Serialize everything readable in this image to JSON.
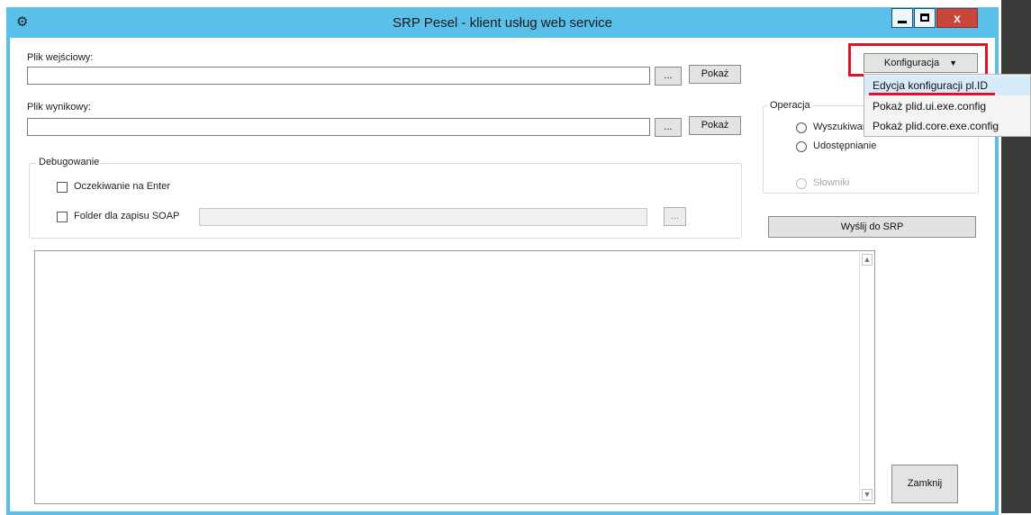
{
  "window": {
    "title": "SRP Pesel - klient usług web service",
    "app_icon": "gear-icon",
    "close_glyph": "x",
    "accent_color": "#5bc0e9"
  },
  "input_file": {
    "label": "Plik wejściowy:",
    "value": "",
    "browse_label": "...",
    "show_label": "Pokaż"
  },
  "output_file": {
    "label": "Plik wynikowy:",
    "value": "",
    "browse_label": "...",
    "show_label": "Pokaż"
  },
  "debug": {
    "title": "Debugowanie",
    "wait_enter_label": "Oczekiwanie na Enter",
    "wait_enter_checked": false,
    "soap_folder_label": "Folder dla zapisu SOAP",
    "soap_folder_checked": false,
    "soap_folder_value": "",
    "browse_label": "..."
  },
  "config": {
    "button_label": "Konfiguracja",
    "menu_items": [
      "Edycja konfiguracji pl.ID",
      "Pokaż plid.ui.exe.config",
      "Pokaż plid.core.exe.config"
    ],
    "highlight_color": "#e0112b"
  },
  "operation": {
    "title": "Operacja",
    "options": [
      "Wyszukiwanie",
      "Udostępnianie",
      "Słowniki"
    ]
  },
  "send_button": "Wyślij do SRP",
  "close_button": "Zamknij",
  "output_log": ""
}
